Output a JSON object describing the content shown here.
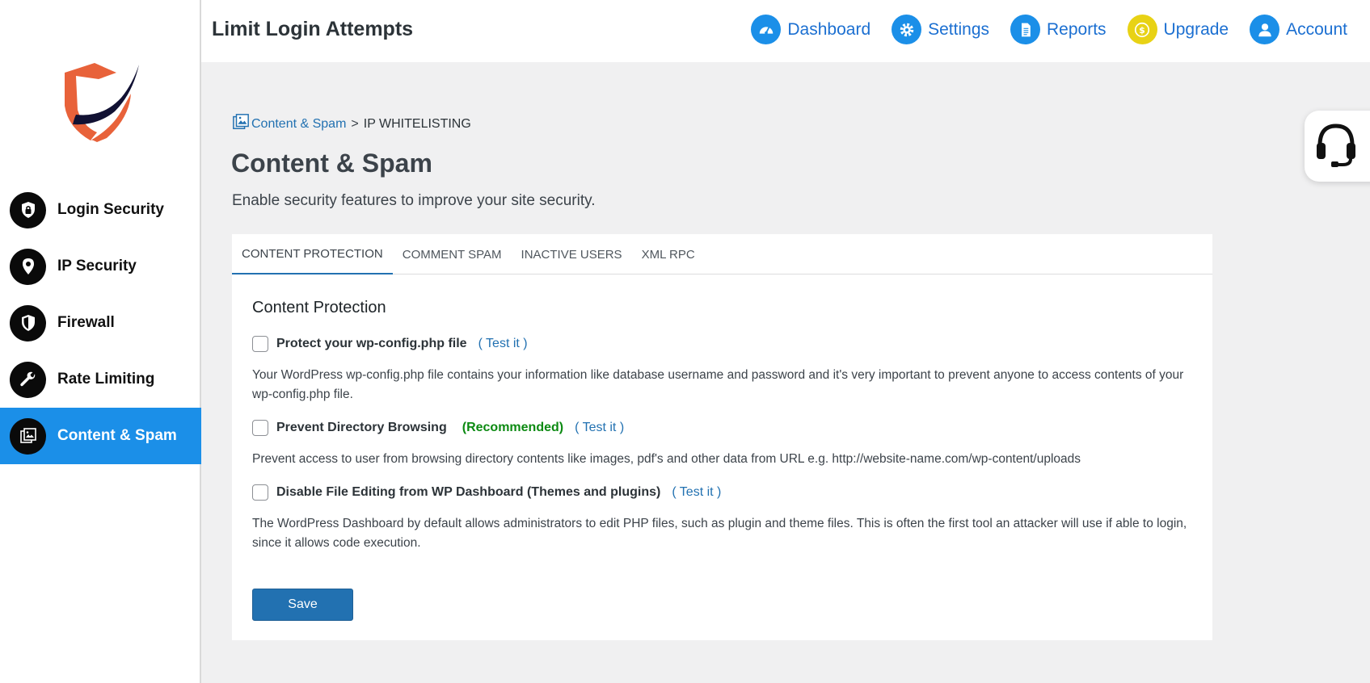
{
  "header": {
    "title": "Limit Login Attempts",
    "links": [
      {
        "label": "Dashboard",
        "icon": "speedometer-icon"
      },
      {
        "label": "Settings",
        "icon": "gear-icon"
      },
      {
        "label": "Reports",
        "icon": "document-icon"
      },
      {
        "label": "Upgrade",
        "icon": "dollar-coin-icon"
      },
      {
        "label": "Account",
        "icon": "user-icon"
      }
    ]
  },
  "sidebar": {
    "items": [
      {
        "label": "Login Security",
        "icon": "lock-shield-icon"
      },
      {
        "label": "IP Security",
        "icon": "location-pin-icon"
      },
      {
        "label": "Firewall",
        "icon": "shield-icon"
      },
      {
        "label": "Rate Limiting",
        "icon": "wrench-icon"
      },
      {
        "label": "Content & Spam",
        "icon": "gallery-icon",
        "active": true
      }
    ]
  },
  "breadcrumb": {
    "link": "Content & Spam",
    "separator": ">",
    "current": "IP WHITELISTING"
  },
  "page": {
    "title": "Content & Spam",
    "subtitle": "Enable security features to improve your site security."
  },
  "tabs": [
    {
      "label": "CONTENT PROTECTION",
      "active": true
    },
    {
      "label": "COMMENT SPAM"
    },
    {
      "label": "INACTIVE USERS"
    },
    {
      "label": "XML RPC"
    }
  ],
  "section": {
    "title": "Content Protection",
    "options": [
      {
        "label": "Protect your wp-config.php file",
        "test": "( Test it )",
        "description": "Your WordPress wp-config.php file contains your information like database username and password and it's very important to prevent anyone to access contents of your wp-config.php file."
      },
      {
        "label": "Prevent Directory Browsing",
        "recommended": "(Recommended)",
        "test": "( Test it )",
        "description": "Prevent access to user from browsing directory contents like images, pdf's and other data from URL e.g. http://website-name.com/wp-content/uploads"
      },
      {
        "label": "Disable File Editing from WP Dashboard (Themes and plugins)",
        "test": "( Test it )",
        "description": "The WordPress Dashboard by default allows administrators to edit PHP files, such as plugin and theme files. This is often the first tool an attacker will use if able to login, since it allows code execution."
      }
    ],
    "save_label": "Save"
  },
  "colors": {
    "accent": "#1b8fe8",
    "link": "#2271b1",
    "recommended": "#0c8a12",
    "upgrade": "#e8d215"
  }
}
